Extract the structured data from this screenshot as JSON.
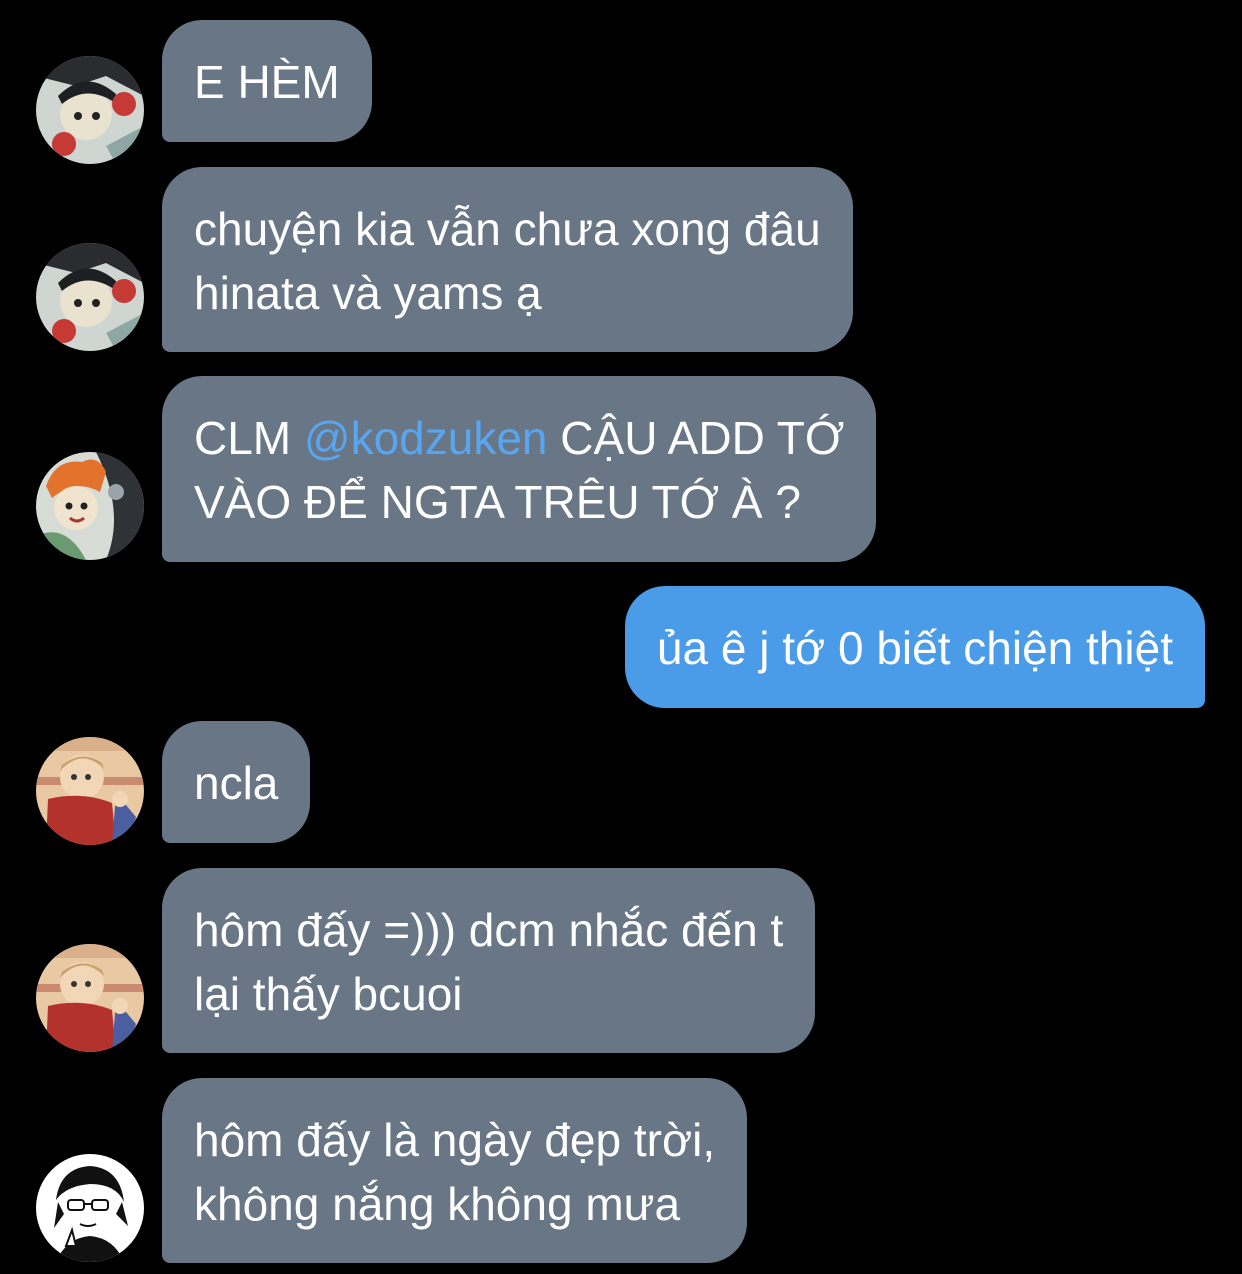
{
  "conversation": {
    "messages": [
      {
        "direction": "in",
        "sender": "user-a",
        "lines": [
          "E HÈM"
        ]
      },
      {
        "direction": "in",
        "sender": "user-a",
        "lines": [
          "chuyện kia vẫn chưa xong đâu",
          "hinata và yams ạ"
        ]
      },
      {
        "direction": "in",
        "sender": "user-b",
        "line1_before": "CLM ",
        "mention": "@kodzuken",
        "line1_after": " CẬU ADD TỚ",
        "line2": "VÀO ĐỂ NGTA TRÊU TỚ À ?"
      },
      {
        "direction": "out",
        "lines": [
          "ủa ê j tớ 0 biết chiện thiệt"
        ]
      },
      {
        "direction": "in",
        "sender": "user-c",
        "lines": [
          "ncla"
        ]
      },
      {
        "direction": "in",
        "sender": "user-c",
        "lines": [
          "hôm đấy =))) dcm nhắc đến t",
          "lại thấy bcuoi"
        ]
      },
      {
        "direction": "in",
        "sender": "user-d",
        "lines": [
          "hôm đấy là ngày đẹp trời,",
          "không nắng không mưa"
        ]
      }
    ]
  },
  "colors": {
    "background": "#000000",
    "incoming_bubble": "#687685",
    "outgoing_bubble": "#4a9be8",
    "mention": "#58a6f0",
    "text": "#ffffff"
  },
  "icons": {
    "avatar_a": "manga-character-avatar",
    "avatar_b": "orange-hair-character-avatar",
    "avatar_c": "red-scarf-character-avatar",
    "avatar_d": "glasses-character-sketch-avatar"
  }
}
